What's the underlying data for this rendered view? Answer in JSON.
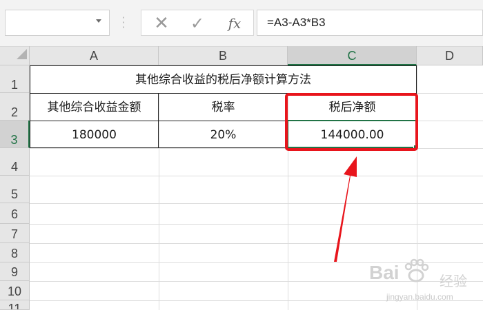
{
  "formula_bar": {
    "name_box_value": "",
    "cancel_icon": "✕",
    "enter_icon": "✓",
    "function_icon": "fx",
    "formula": "=A3-A3*B3"
  },
  "columns": [
    "A",
    "B",
    "C",
    "D"
  ],
  "rows": [
    "1",
    "2",
    "3",
    "4",
    "5",
    "6",
    "7",
    "8",
    "9",
    "10",
    "11"
  ],
  "selected_cell": "C3",
  "cells": {
    "title": "其他综合收益的税后净额计算方法",
    "header_a": "其他综合收益金额",
    "header_b": "税率",
    "header_c": "税后净额",
    "value_a": "180000",
    "value_b": "20%",
    "value_c": "144000.00"
  },
  "watermark": {
    "brand": "Bai",
    "brand_suffix": "经验",
    "url": "jingyan.baidu.com"
  },
  "colors": {
    "accent_green": "#217346",
    "highlight_red": "#e8151c"
  }
}
